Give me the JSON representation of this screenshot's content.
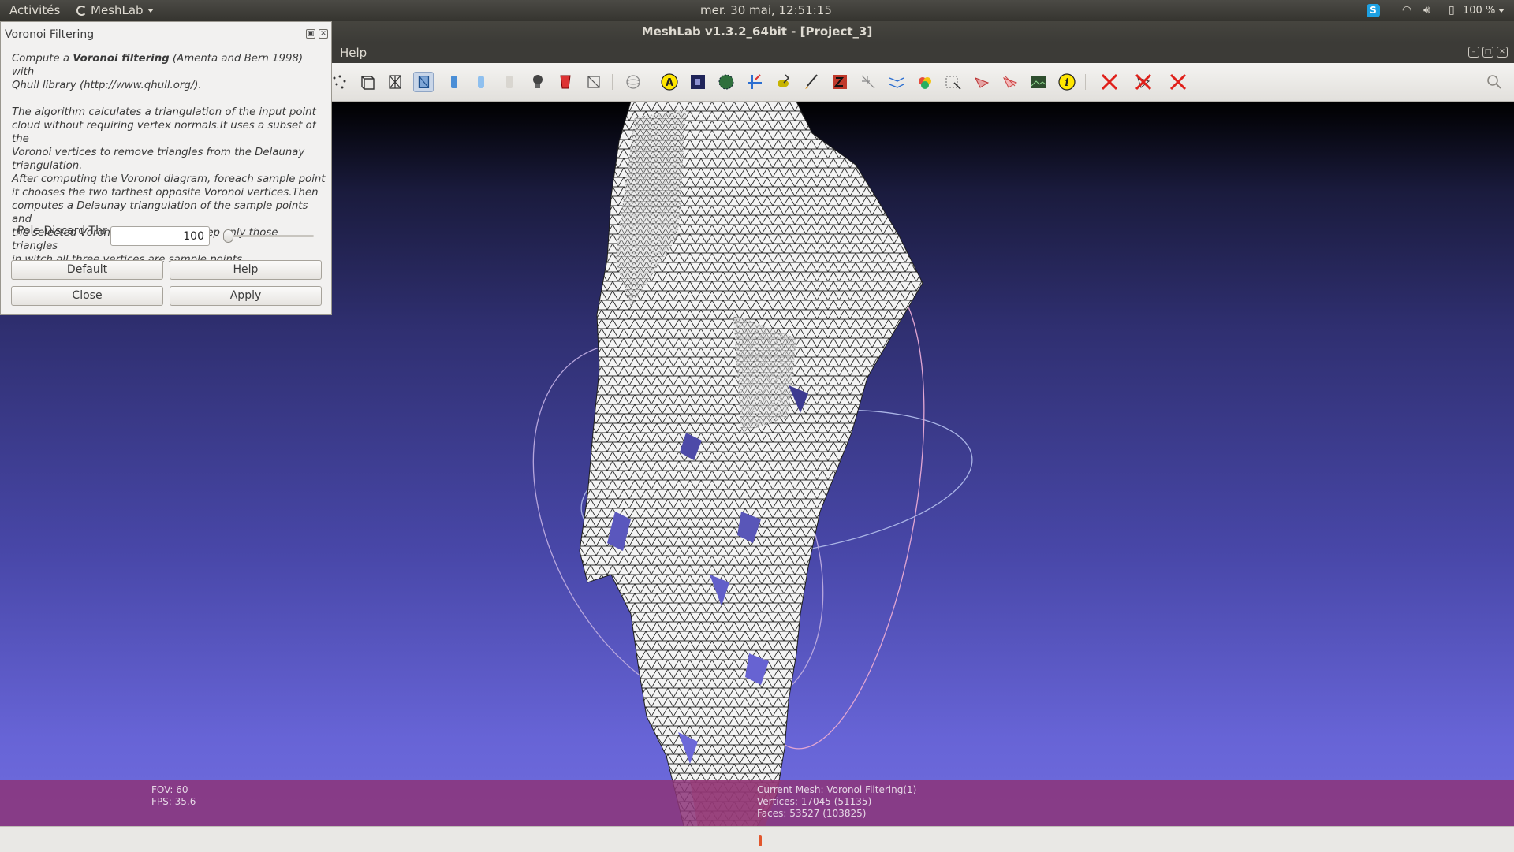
{
  "top_panel": {
    "activities": "Activités",
    "app_menu": "MeshLab",
    "clock": "mer. 30 mai, 12:51:15",
    "battery": "100 %",
    "skype_glyph": "S"
  },
  "window": {
    "title": "MeshLab v1.3.2_64bit - [Project_3]"
  },
  "menubar": {
    "help": "Help"
  },
  "toolbar": {
    "icons": [
      "select-points-icon",
      "bounding-box-icon",
      "wireframe-icon",
      "hidden-lines-icon",
      "flat-shading-icon",
      "smooth-shading-icon",
      "texture-icon",
      "light-icon",
      "backface-icon",
      "double-side-icon",
      "trackball-icon",
      "annotation-icon",
      "raster-layer-icon",
      "sphere-icon",
      "measure-tool-icon",
      "pick-points-icon",
      "paint-icon",
      "z-painting-icon",
      "align-icon",
      "manipulator-icon",
      "color-icon",
      "select-faces-icon",
      "select-vertices-icon",
      "select-connected-icon",
      "snapshot-icon",
      "info-icon",
      "delete-selection-icon",
      "delete-faces-icon",
      "delete-vertices-icon"
    ],
    "search_icon": "search-icon"
  },
  "dialog": {
    "title": "Voronoi Filtering",
    "desc_line1_pre": "Compute a ",
    "desc_line1_bold": "Voronoi filtering",
    "desc_line1_post": " (Amenta and Bern 1998) with",
    "desc_line2": "Qhull library (http://www.qhull.org/).",
    "desc_p2": [
      "The algorithm calculates a triangulation of the input point",
      "cloud without requiring vertex normals.It uses a subset of the",
      "Voronoi vertices to remove triangles from the Delaunay",
      "triangulation.",
      "After computing the Voronoi diagram, foreach sample point",
      "it chooses the two farthest opposite Voronoi vertices.Then",
      "computes a Delaunay triangulation of the sample points and",
      "the selected Voronoi vertices, and keep only those triangles",
      "in witch all three vertices are sample points."
    ],
    "param_label": "Pole Discard Thr",
    "param_value": "100",
    "param_slider_fraction": 0.04,
    "buttons": {
      "default": "Default",
      "help": "Help",
      "close": "Close",
      "apply": "Apply"
    }
  },
  "info": {
    "fov": "FOV: 60",
    "fps": "FPS:   35.6",
    "current_mesh": "Current Mesh: Voronoi Filtering(1)",
    "vertices": "Vertices: 17045 (51135)",
    "faces": "Faces: 53527 (103825)"
  },
  "colors": {
    "accent": "#e2562c",
    "info_bar": "#8c3478",
    "viewport_top": "#000000",
    "viewport_bottom": "#726ee0"
  }
}
